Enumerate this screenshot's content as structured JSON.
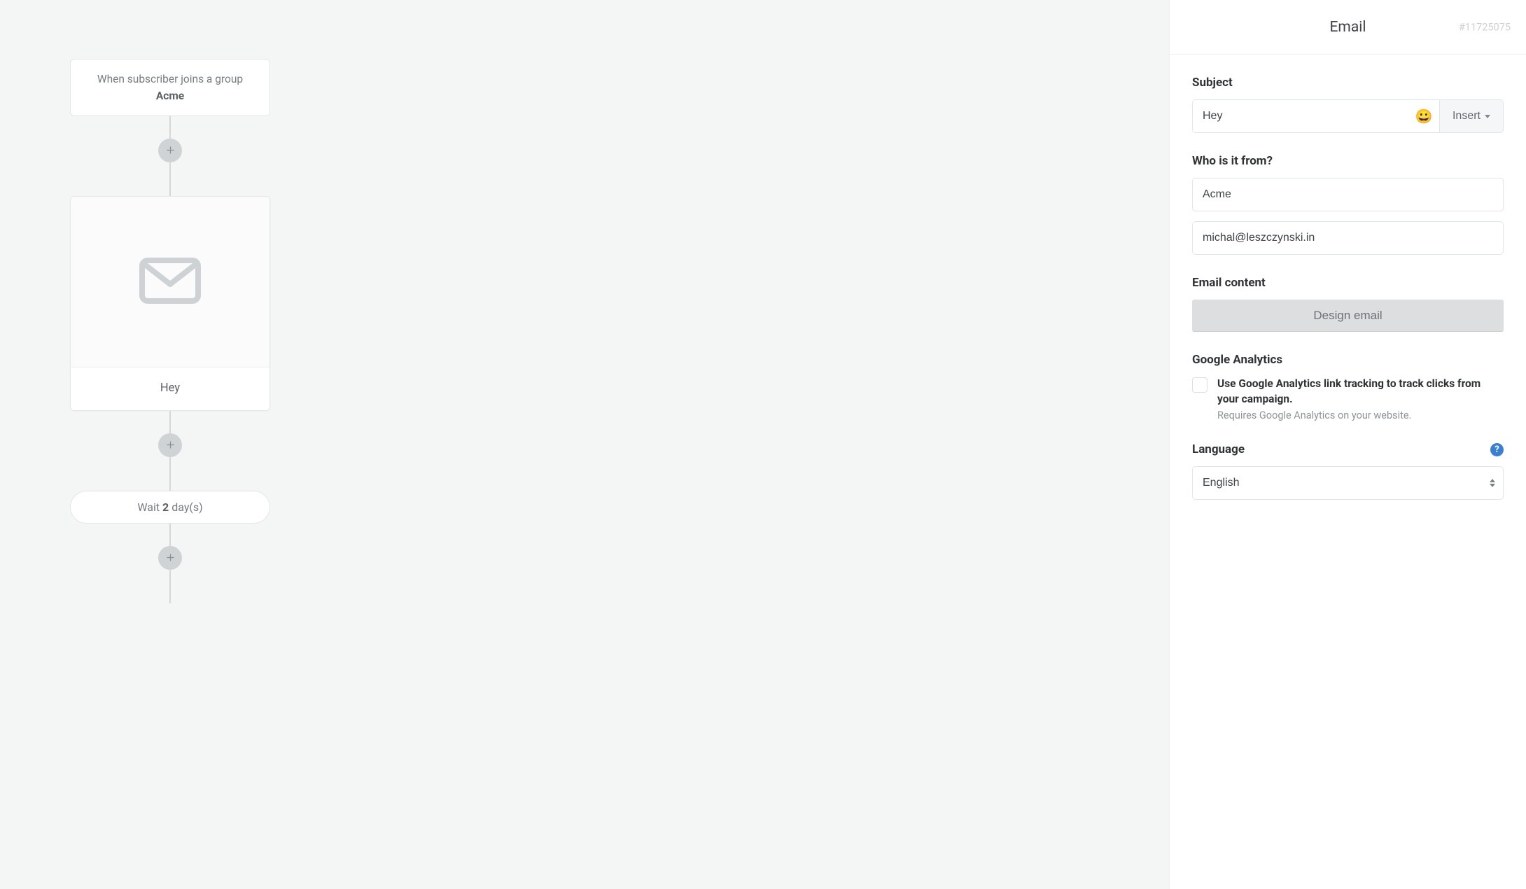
{
  "canvas": {
    "trigger": {
      "prefix": "When subscriber joins a group",
      "group": "Acme"
    },
    "email_card": {
      "title": "Hey"
    },
    "delay": {
      "prefix": "Wait ",
      "number": "2",
      "suffix": " day(s)"
    }
  },
  "sidebar": {
    "header": {
      "title": "Email",
      "id": "#11725075"
    },
    "subject": {
      "label": "Subject",
      "value": "Hey",
      "emoji": "😀",
      "insert_label": "Insert"
    },
    "from": {
      "label": "Who is it from?",
      "name": "Acme",
      "email": "michal@leszczynski.in"
    },
    "content": {
      "label": "Email content",
      "button": "Design email"
    },
    "ga": {
      "label": "Google Analytics",
      "checkbox_main": "Use Google Analytics link tracking to track clicks from your campaign.",
      "checkbox_sub": "Requires Google Analytics on your website."
    },
    "language": {
      "label": "Language",
      "value": "English",
      "help": "?"
    }
  }
}
